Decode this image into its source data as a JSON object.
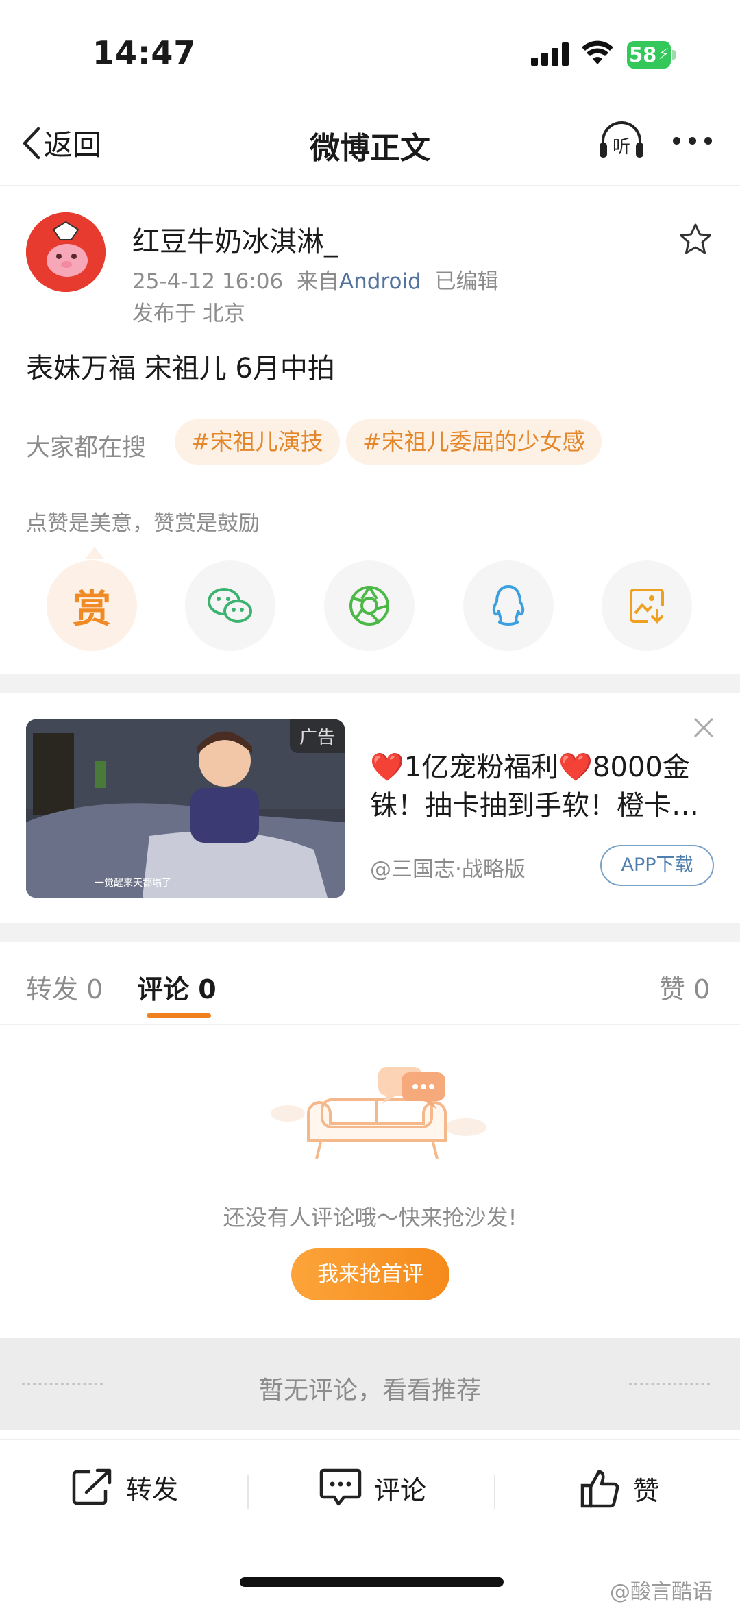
{
  "status_bar": {
    "time": "14:47",
    "battery": "58"
  },
  "nav": {
    "back_label": "返回",
    "title": "微博正文",
    "listen_label": "听"
  },
  "post": {
    "username": "红豆牛奶冰淇淋_",
    "date": "25-4-12 16:06",
    "source_prefix": "来自",
    "source": "Android",
    "edited": "已编辑",
    "location": "发布于 北京",
    "text": "表妹万福 宋祖儿 6月中拍"
  },
  "search": {
    "label": "大家都在搜",
    "tags": [
      "#宋祖儿演技",
      "#宋祖儿委屈的少女感"
    ]
  },
  "share": {
    "tip": "点赞是美意，赞赏是鼓励",
    "reward_label": "赏"
  },
  "ad": {
    "tag": "广告",
    "title": "❤️1亿宠粉福利❤️8000金铢！抽卡抽到手软！橙卡…",
    "source": "@三国志·战略版",
    "button": "APP下载",
    "caption": "一觉醒来天都塌了"
  },
  "tabs": [
    {
      "label": "转发 0"
    },
    {
      "label": "评论 0"
    },
    {
      "label": "赞 0"
    }
  ],
  "empty": {
    "text": "还没有人评论哦～快来抢沙发!",
    "button": "我来抢首评"
  },
  "recommend": {
    "text": "暂无评论，看看推荐"
  },
  "bottom_bar": {
    "forward": "转发",
    "comment": "评论",
    "like": "赞"
  },
  "watermark": "@酸言酷语",
  "colors": {
    "accent": "#f07f1d",
    "link": "#53739c",
    "tag_bg": "#fdf0e4",
    "tag_text": "#e4862a"
  }
}
